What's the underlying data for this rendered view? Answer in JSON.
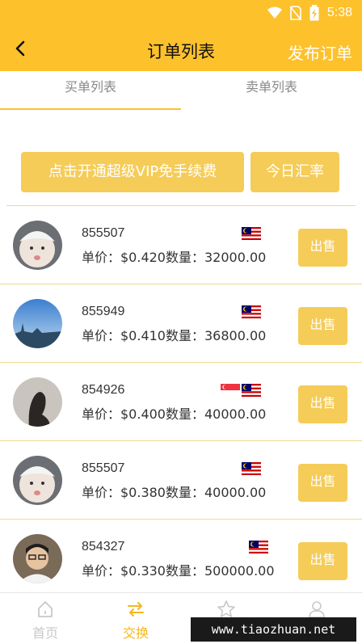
{
  "status_bar": {
    "time": "5:38"
  },
  "nav": {
    "title": "订单列表",
    "publish_label": "发布订单"
  },
  "tabs": [
    {
      "label": "买单列表",
      "active": true
    },
    {
      "label": "卖单列表",
      "active": false
    }
  ],
  "actions": {
    "vip_label": "点击开通超级VIP免手续费",
    "rate_label": "今日汇率"
  },
  "orders": [
    {
      "id": "855507",
      "price_text": "单价：$0.420数量：32000.00",
      "flags": [
        "malaysia-flag"
      ],
      "sell_label": "出售"
    },
    {
      "id": "855949",
      "price_text": "单价：$0.410数量：36800.00",
      "flags": [
        "malaysia-flag"
      ],
      "sell_label": "出售"
    },
    {
      "id": "854926",
      "price_text": "单价：$0.400数量：40000.00",
      "flags": [
        "singapore-flag",
        "malaysia-flag"
      ],
      "sell_label": "出售"
    },
    {
      "id": "855507",
      "price_text": "单价：$0.380数量：40000.00",
      "flags": [
        "malaysia-flag"
      ],
      "sell_label": "出售"
    },
    {
      "id": "854327",
      "price_text": "单价：$0.330数量：500000.00",
      "flags": [
        "malaysia-flag"
      ],
      "sell_label": "出售"
    }
  ],
  "bottom_nav": [
    {
      "label": "首页",
      "icon": "home-icon",
      "active": false
    },
    {
      "label": "交换",
      "icon": "exchange-icon",
      "active": true
    },
    {
      "label": "",
      "icon": "star-icon",
      "active": false
    },
    {
      "label": "",
      "icon": "user-icon",
      "active": false
    }
  ],
  "watermark": "www.tiaozhuan.net",
  "colors": {
    "accent": "#fdc12c",
    "button": "#f5cc58",
    "divider": "#f0d98e"
  }
}
